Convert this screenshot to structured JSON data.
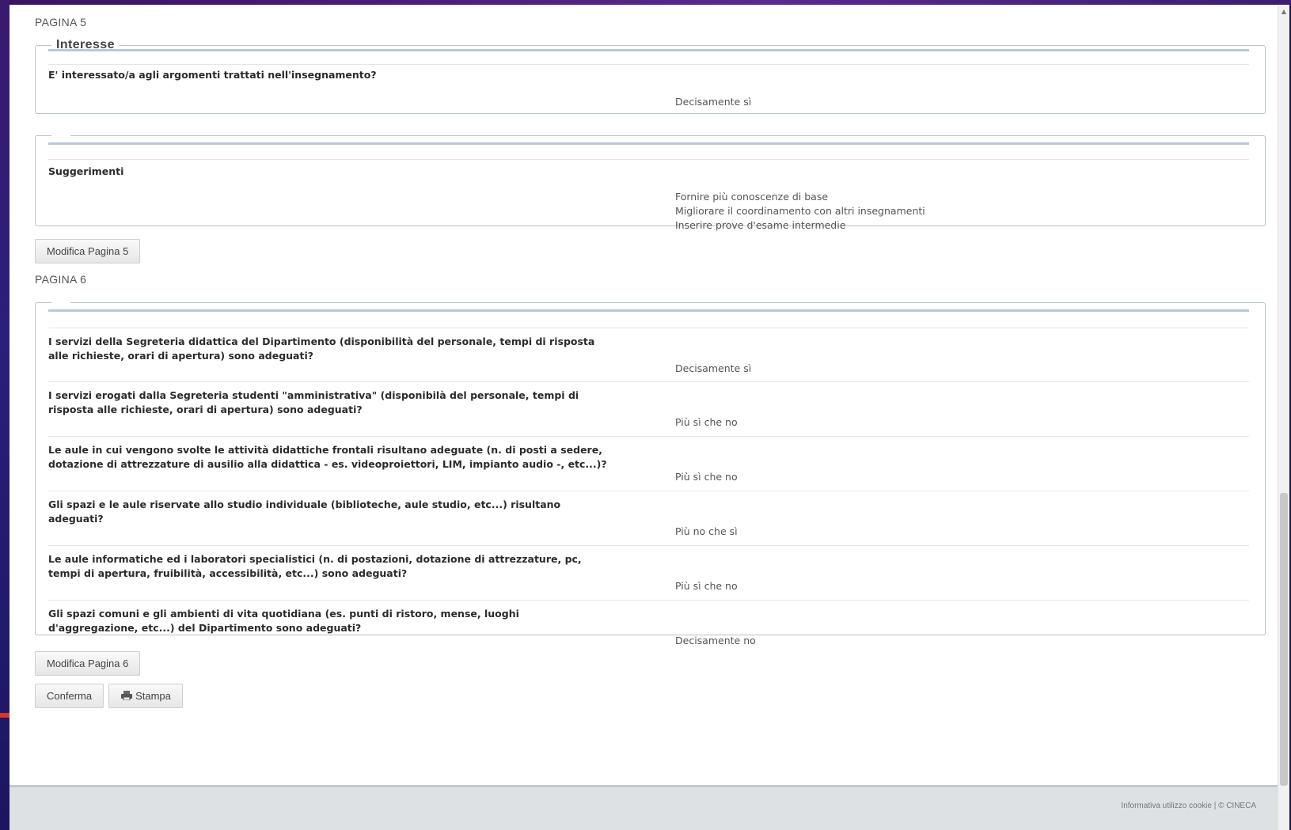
{
  "page5": {
    "label": "PAGINA 5",
    "interest_section": {
      "legend": "Interesse",
      "question": "E' interessato/a agli argomenti trattati nell'insegnamento?",
      "answer": "Decisamente sì"
    },
    "suggestions_section": {
      "question": "Suggerimenti",
      "answers": [
        "Fornire più conoscenze di base",
        "Migliorare il coordinamento con altri insegnamenti",
        "Inserire prove d'esame intermedie"
      ]
    },
    "edit_button": "Modifica Pagina 5"
  },
  "page6": {
    "label": "PAGINA 6",
    "rows": [
      {
        "question": "I servizi della Segreteria didattica del Dipartimento (disponibilità del personale, tempi di risposta alle richieste, orari di apertura) sono adeguati?",
        "answer": "Decisamente sì"
      },
      {
        "question": "I servizi erogati dalla Segreteria studenti \"amministrativa\" (disponibilà del personale, tempi di risposta alle richieste, orari di apertura) sono adeguati?",
        "answer": "Più sì che no"
      },
      {
        "question": "Le aule in cui vengono svolte le attività didattiche frontali risultano adeguate (n. di posti a sedere, dotazione di attrezzature di ausilio alla didattica - es. videoproiettori, LIM, impianto audio -, etc...)?",
        "answer": "Più sì che no"
      },
      {
        "question": "Gli spazi e le aule riservate allo studio individuale (biblioteche, aule studio, etc...) risultano adeguati?",
        "answer": "Più no che sì"
      },
      {
        "question": "Le aule informatiche ed i laboratori specialistici (n. di postazioni, dotazione di attrezzature, pc, tempi di apertura, fruibilità, accessibilità, etc...) sono adeguati?",
        "answer": "Più sì che no"
      },
      {
        "question": "Gli spazi comuni e gli ambienti di vita quotidiana (es. punti di ristoro, mense, luoghi d'aggregazione, etc...) del Dipartimento sono adeguati?",
        "answer": "Decisamente no"
      }
    ],
    "edit_button": "Modifica Pagina 6"
  },
  "actions": {
    "confirm_button": "Conferma",
    "print_button": "Stampa"
  },
  "footer": {
    "text": "Informativa utilizzo cookie | © CINECA"
  },
  "colors": {
    "desktop_bg": "#1e0f4a",
    "fieldset_rule": "#b8c9d8",
    "arrow": "#d9362b"
  }
}
